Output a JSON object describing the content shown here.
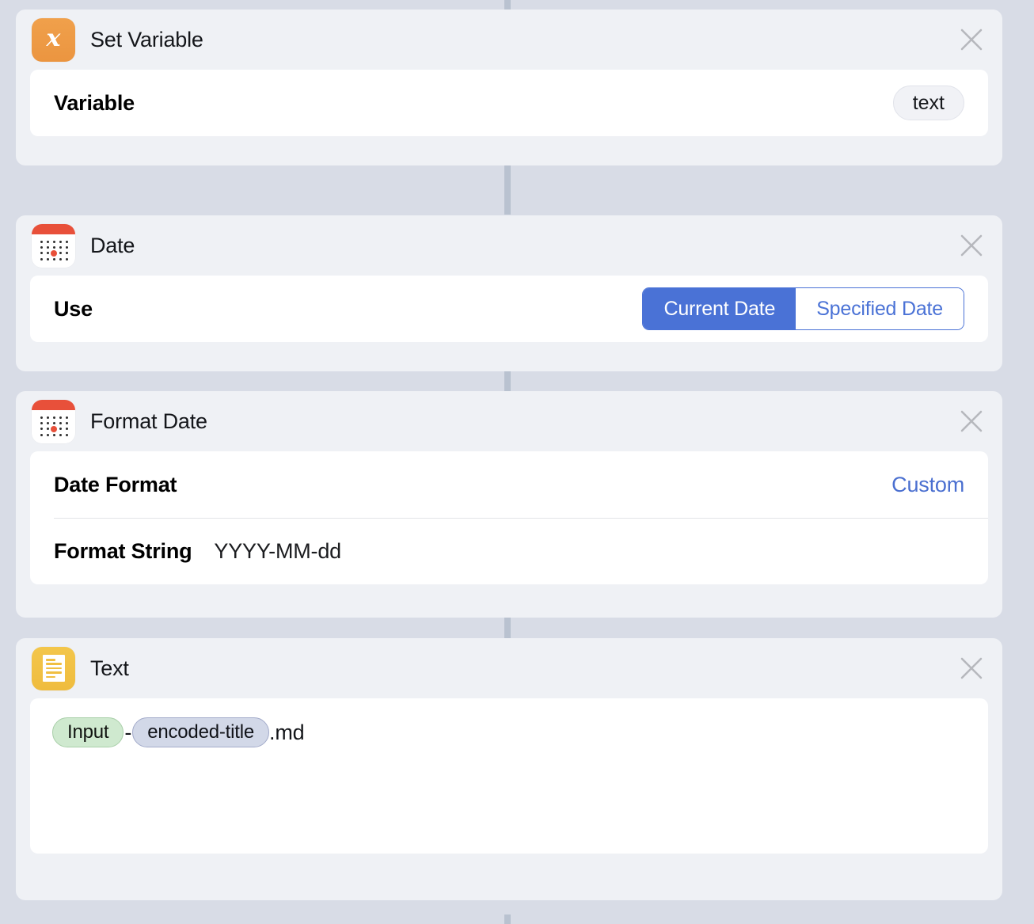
{
  "theme": {
    "page_background": "#d8dce6",
    "card_background": "#eff1f5",
    "panel_background": "#ffffff",
    "accent_blue": "#4a72d6",
    "connector": "#b9c2d0"
  },
  "close_icon_label": "close-icon",
  "cards": [
    {
      "id": "set-variable",
      "title": "Set Variable",
      "icon": "x-variable-icon",
      "rows": [
        {
          "label": "Variable",
          "value_pill": "text"
        }
      ]
    },
    {
      "id": "date",
      "title": "Date",
      "icon": "calendar-icon",
      "rows": [
        {
          "label": "Use",
          "segmented": {
            "options": [
              "Current Date",
              "Specified Date"
            ],
            "selected": "Current Date"
          }
        }
      ]
    },
    {
      "id": "format-date",
      "title": "Format Date",
      "icon": "calendar-icon",
      "rows": [
        {
          "label": "Date Format",
          "value_link": "Custom"
        },
        {
          "label": "Format String",
          "value_inline": "YYYY-MM-dd"
        }
      ]
    },
    {
      "id": "text",
      "title": "Text",
      "icon": "document-icon",
      "text_content": {
        "token_input": "Input",
        "separator": "-",
        "token_variable": "encoded-title",
        "suffix": ".md"
      }
    }
  ]
}
